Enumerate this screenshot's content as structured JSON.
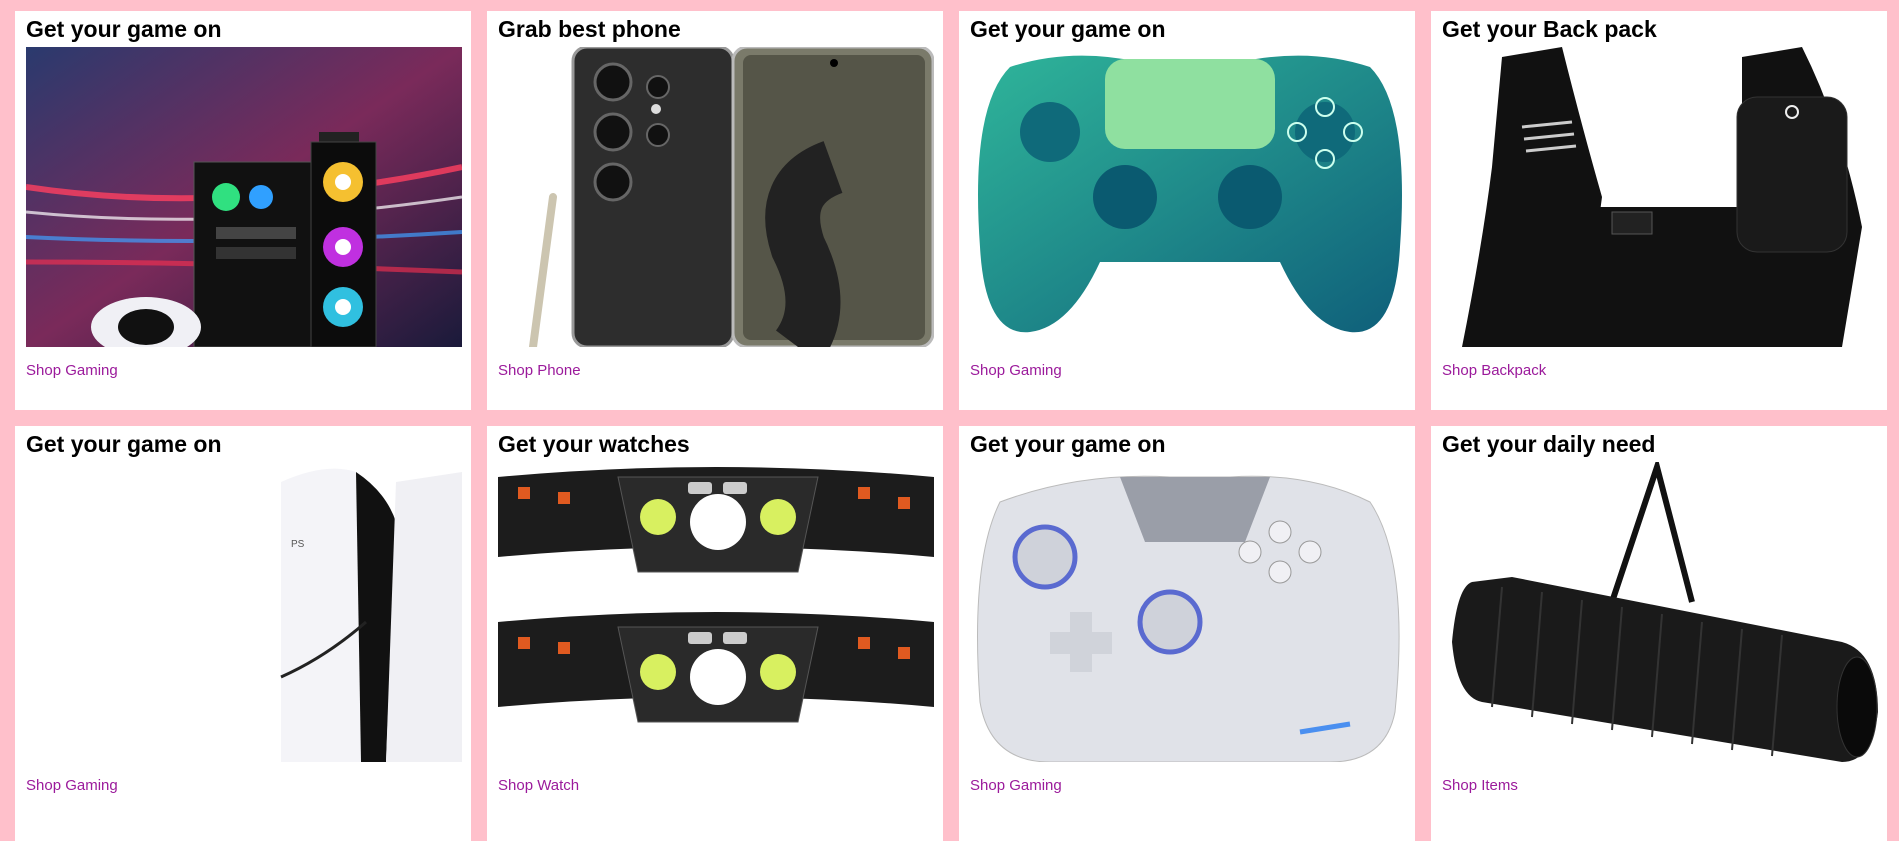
{
  "cards": [
    {
      "title": "Get your game on",
      "link": "Shop Gaming",
      "image": "gaming-pc-image"
    },
    {
      "title": "Grab best phone",
      "link": "Shop Phone",
      "image": "foldable-phone-image"
    },
    {
      "title": "Get your game on",
      "link": "Shop Gaming",
      "image": "teal-controller-image"
    },
    {
      "title": "Get your Back pack",
      "link": "Shop Backpack",
      "image": "sling-backpack-image"
    },
    {
      "title": "Get your game on",
      "link": "Shop Gaming",
      "image": "console-image"
    },
    {
      "title": "Get your watches",
      "link": "Shop Watch",
      "image": "headlamp-image"
    },
    {
      "title": "Get your game on",
      "link": "Shop Gaming",
      "image": "white-controller-image"
    },
    {
      "title": "Get your daily need",
      "link": "Shop Items",
      "image": "yoga-mat-image"
    }
  ],
  "colors": {
    "page_background": "#ffc0cb",
    "card_background": "#ffffff",
    "link": "#9b1a9b"
  }
}
